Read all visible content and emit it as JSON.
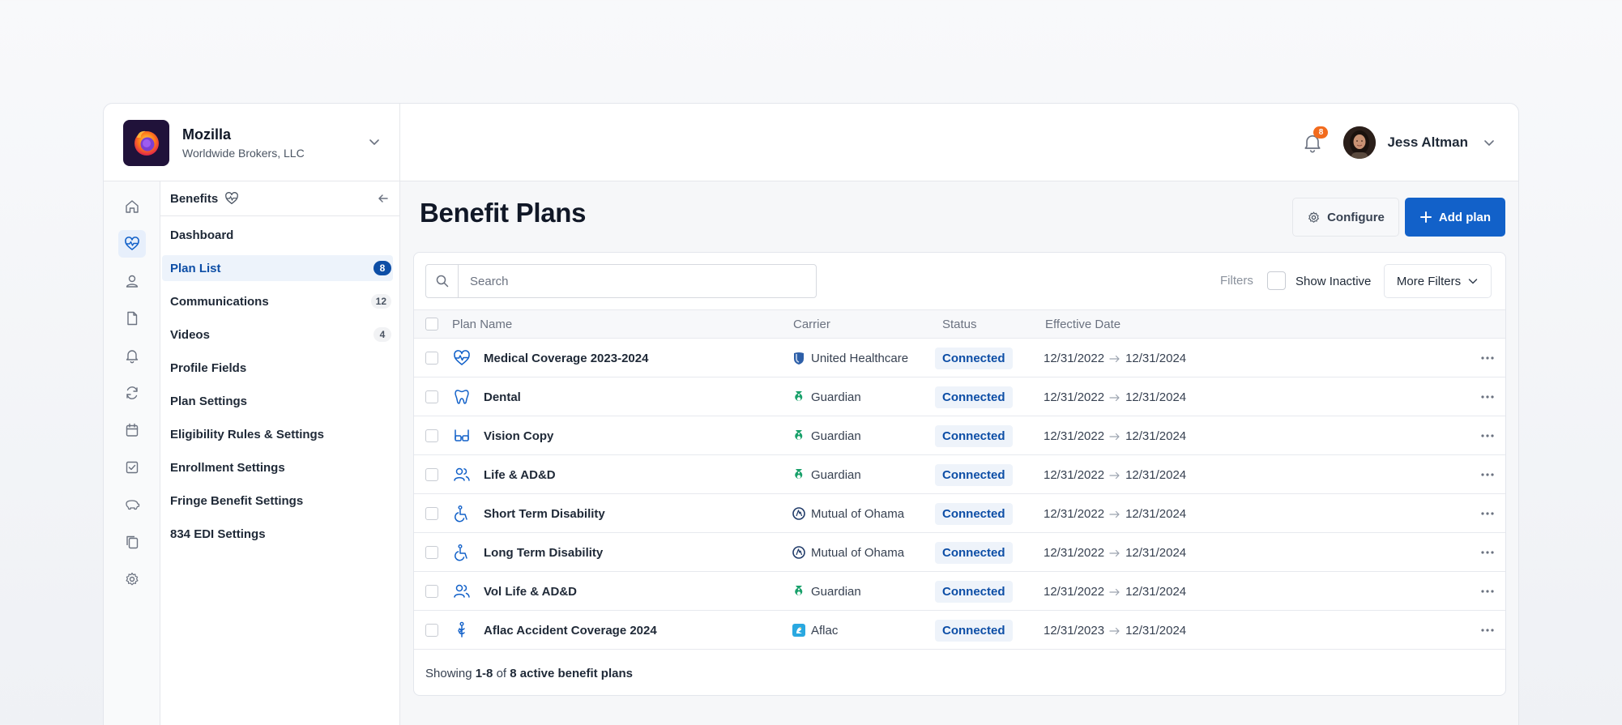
{
  "org": {
    "name": "Mozilla",
    "subtitle": "Worldwide Brokers, LLC"
  },
  "header": {
    "notification_count": "8",
    "user_name": "Jess Altman"
  },
  "rail": {
    "items": [
      "home-icon",
      "heart-pulse-icon",
      "user-icon",
      "document-icon",
      "bell-icon",
      "refresh-icon",
      "calendar-icon",
      "checkbox-icon",
      "piggy-bank-icon",
      "copy-icon",
      "gear-icon"
    ],
    "active_index": 1
  },
  "subnav": {
    "title": "Benefits",
    "items": [
      {
        "label": "Dashboard",
        "badge": ""
      },
      {
        "label": "Plan List",
        "badge": "8"
      },
      {
        "label": "Communications",
        "badge": "12"
      },
      {
        "label": "Videos",
        "badge": "4"
      },
      {
        "label": "Profile Fields",
        "badge": ""
      },
      {
        "label": "Plan Settings",
        "badge": ""
      },
      {
        "label": "Eligibility Rules & Settings",
        "badge": ""
      },
      {
        "label": "Enrollment Settings",
        "badge": ""
      },
      {
        "label": "Fringe Benefit Settings",
        "badge": ""
      },
      {
        "label": "834 EDI Settings",
        "badge": ""
      }
    ]
  },
  "main": {
    "title": "Benefit Plans",
    "configure_label": "Configure",
    "add_label": "Add plan",
    "search_placeholder": "Search",
    "filters_label": "Filters",
    "show_inactive_label": "Show Inactive",
    "more_filters_label": "More Filters",
    "columns": {
      "plan_name": "Plan Name",
      "carrier": "Carrier",
      "status": "Status",
      "effective_date": "Effective Date"
    },
    "rows": [
      {
        "plan": "Medical Coverage 2023-2024",
        "icon": "heart-pulse-icon",
        "carrier": "United Healthcare",
        "carrier_logo": "united-healthcare-logo",
        "status": "Connected",
        "start": "12/31/2022",
        "end": "12/31/2024"
      },
      {
        "plan": "Dental",
        "icon": "tooth-icon",
        "carrier": "Guardian",
        "carrier_logo": "guardian-logo",
        "status": "Connected",
        "start": "12/31/2022",
        "end": "12/31/2024"
      },
      {
        "plan": "Vision Copy",
        "icon": "glasses-icon",
        "carrier": "Guardian",
        "carrier_logo": "guardian-logo",
        "status": "Connected",
        "start": "12/31/2022",
        "end": "12/31/2024"
      },
      {
        "plan": "Life & AD&D",
        "icon": "users-icon",
        "carrier": "Guardian",
        "carrier_logo": "guardian-logo",
        "status": "Connected",
        "start": "12/31/2022",
        "end": "12/31/2024"
      },
      {
        "plan": "Short Term Disability",
        "icon": "wheelchair-icon",
        "carrier": "Mutual of Ohama",
        "carrier_logo": "mutual-of-omaha-logo",
        "status": "Connected",
        "start": "12/31/2022",
        "end": "12/31/2024"
      },
      {
        "plan": "Long Term Disability",
        "icon": "wheelchair-icon",
        "carrier": "Mutual of Ohama",
        "carrier_logo": "mutual-of-omaha-logo",
        "status": "Connected",
        "start": "12/31/2022",
        "end": "12/31/2024"
      },
      {
        "plan": "Vol Life & AD&D",
        "icon": "users-icon",
        "carrier": "Guardian",
        "carrier_logo": "guardian-logo",
        "status": "Connected",
        "start": "12/31/2022",
        "end": "12/31/2024"
      },
      {
        "plan": "Aflac Accident Coverage 2024",
        "icon": "accident-icon",
        "carrier": "Aflac",
        "carrier_logo": "aflac-logo",
        "status": "Connected",
        "start": "12/31/2023",
        "end": "12/31/2024"
      }
    ],
    "footer": {
      "prefix": "Showing",
      "range": "1-8",
      "middle": "of",
      "total": "8 active benefit plans"
    }
  },
  "colors": {
    "primary": "#1261c9",
    "status_text": "#0d4ea6",
    "badge_orange": "#f26b1d"
  }
}
